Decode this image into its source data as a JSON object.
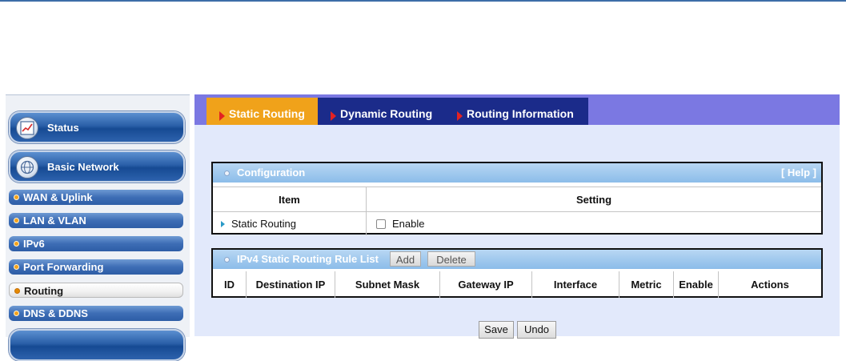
{
  "sidebar": {
    "status_label": "Status",
    "basic_network_label": "Basic Network",
    "items": [
      {
        "label": "WAN & Uplink",
        "active": false
      },
      {
        "label": "LAN & VLAN",
        "active": false
      },
      {
        "label": "IPv6",
        "active": false
      },
      {
        "label": "Port Forwarding",
        "active": false
      },
      {
        "label": "Routing",
        "active": true
      },
      {
        "label": "DNS & DDNS",
        "active": false
      }
    ]
  },
  "tabs": [
    {
      "label": "Static Routing",
      "active": true
    },
    {
      "label": "Dynamic Routing",
      "active": false
    },
    {
      "label": "Routing Information",
      "active": false
    }
  ],
  "configuration": {
    "title": "Configuration",
    "help": "[ Help ]",
    "col_item": "Item",
    "col_setting": "Setting",
    "row_label": "Static Routing",
    "enable_label": "Enable"
  },
  "rule_list": {
    "title": "IPv4 Static Routing Rule List",
    "add_label": "Add",
    "delete_label": "Delete",
    "columns": [
      "ID",
      "Destination IP",
      "Subnet Mask",
      "Gateway IP",
      "Interface",
      "Metric",
      "Enable",
      "Actions"
    ]
  },
  "buttons": {
    "save": "Save",
    "undo": "Undo"
  },
  "colors": {
    "tab_active": "#f0a21a",
    "tab_inactive": "#1b2b8a",
    "tabbar": "#7b78e2",
    "sidebar_blue": "#2a5fa8",
    "panel_header": "#8bbce9"
  }
}
